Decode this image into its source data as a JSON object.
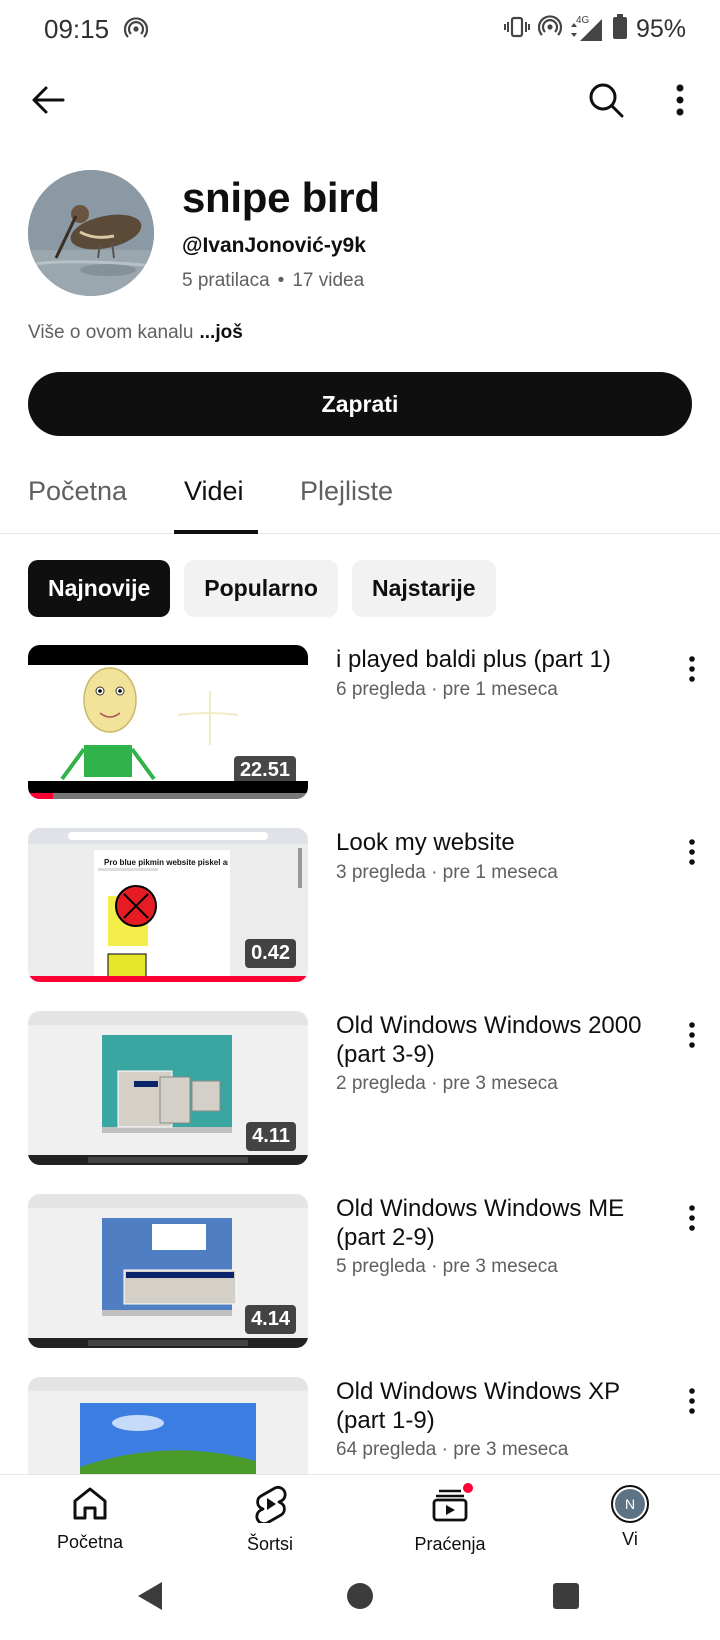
{
  "status_bar": {
    "time": "09:15",
    "battery_percent": "95%",
    "network_label": "4G",
    "icons": [
      "hotspot-icon",
      "vibrate-icon",
      "hotspot-icon",
      "signal-icon",
      "battery-icon"
    ]
  },
  "app_bar": {
    "icons": [
      "back-arrow-icon",
      "search-icon",
      "more-vert-icon"
    ]
  },
  "channel": {
    "name": "snipe bird",
    "handle": "@IvanJonović-y9k",
    "subscribers": "5 pratilaca",
    "separator": "•",
    "videos_count": "17 videa",
    "about": "Više o ovom kanalu",
    "about_more": "...još",
    "subscribe_label": "Zaprati"
  },
  "tabs": [
    {
      "label": "Početna",
      "active": false
    },
    {
      "label": "Videi",
      "active": true
    },
    {
      "label": "Plejliste",
      "active": false
    }
  ],
  "chips": [
    {
      "label": "Najnovije",
      "active": true
    },
    {
      "label": "Popularno",
      "active": false
    },
    {
      "label": "Najstarije",
      "active": false
    }
  ],
  "videos": [
    {
      "title": "i played baldi plus (part 1)",
      "meta": "6 pregleda · pre 1 meseca",
      "duration": "22.51",
      "watched_fraction": 0.09
    },
    {
      "title": "Look my website",
      "meta": "3 pregleda · pre 1 meseca",
      "duration": "0.42",
      "watched_fraction": 1.0
    },
    {
      "title": "Old Windows Windows 2000 (part 3-9)",
      "meta": "2 pregleda · pre 3 meseca",
      "duration": "4.11",
      "watched_fraction": 0
    },
    {
      "title": "Old Windows Windows ME (part 2-9)",
      "meta": "5 pregleda · pre 3 meseca",
      "duration": "4.14",
      "watched_fraction": 0
    },
    {
      "title": "Old Windows Windows XP (part 1-9)",
      "meta": "64 pregleda · pre 3 meseca",
      "duration": "",
      "watched_fraction": 0
    }
  ],
  "thumbnail_texts": {
    "pikmin": "Pro blue pikmin website piskel arts"
  },
  "bottom_nav": [
    {
      "label": "Početna",
      "icon": "home-icon"
    },
    {
      "label": "Šortsi",
      "icon": "shorts-icon"
    },
    {
      "label": "Praćenja",
      "icon": "subscriptions-icon"
    },
    {
      "label": "Vi",
      "icon": "account-avatar",
      "avatar_letter": "N"
    }
  ],
  "colors": {
    "accent_red": "#ff0033",
    "text_primary": "#0f0f0f",
    "text_secondary": "#606060",
    "chip_bg": "#f2f2f2"
  }
}
